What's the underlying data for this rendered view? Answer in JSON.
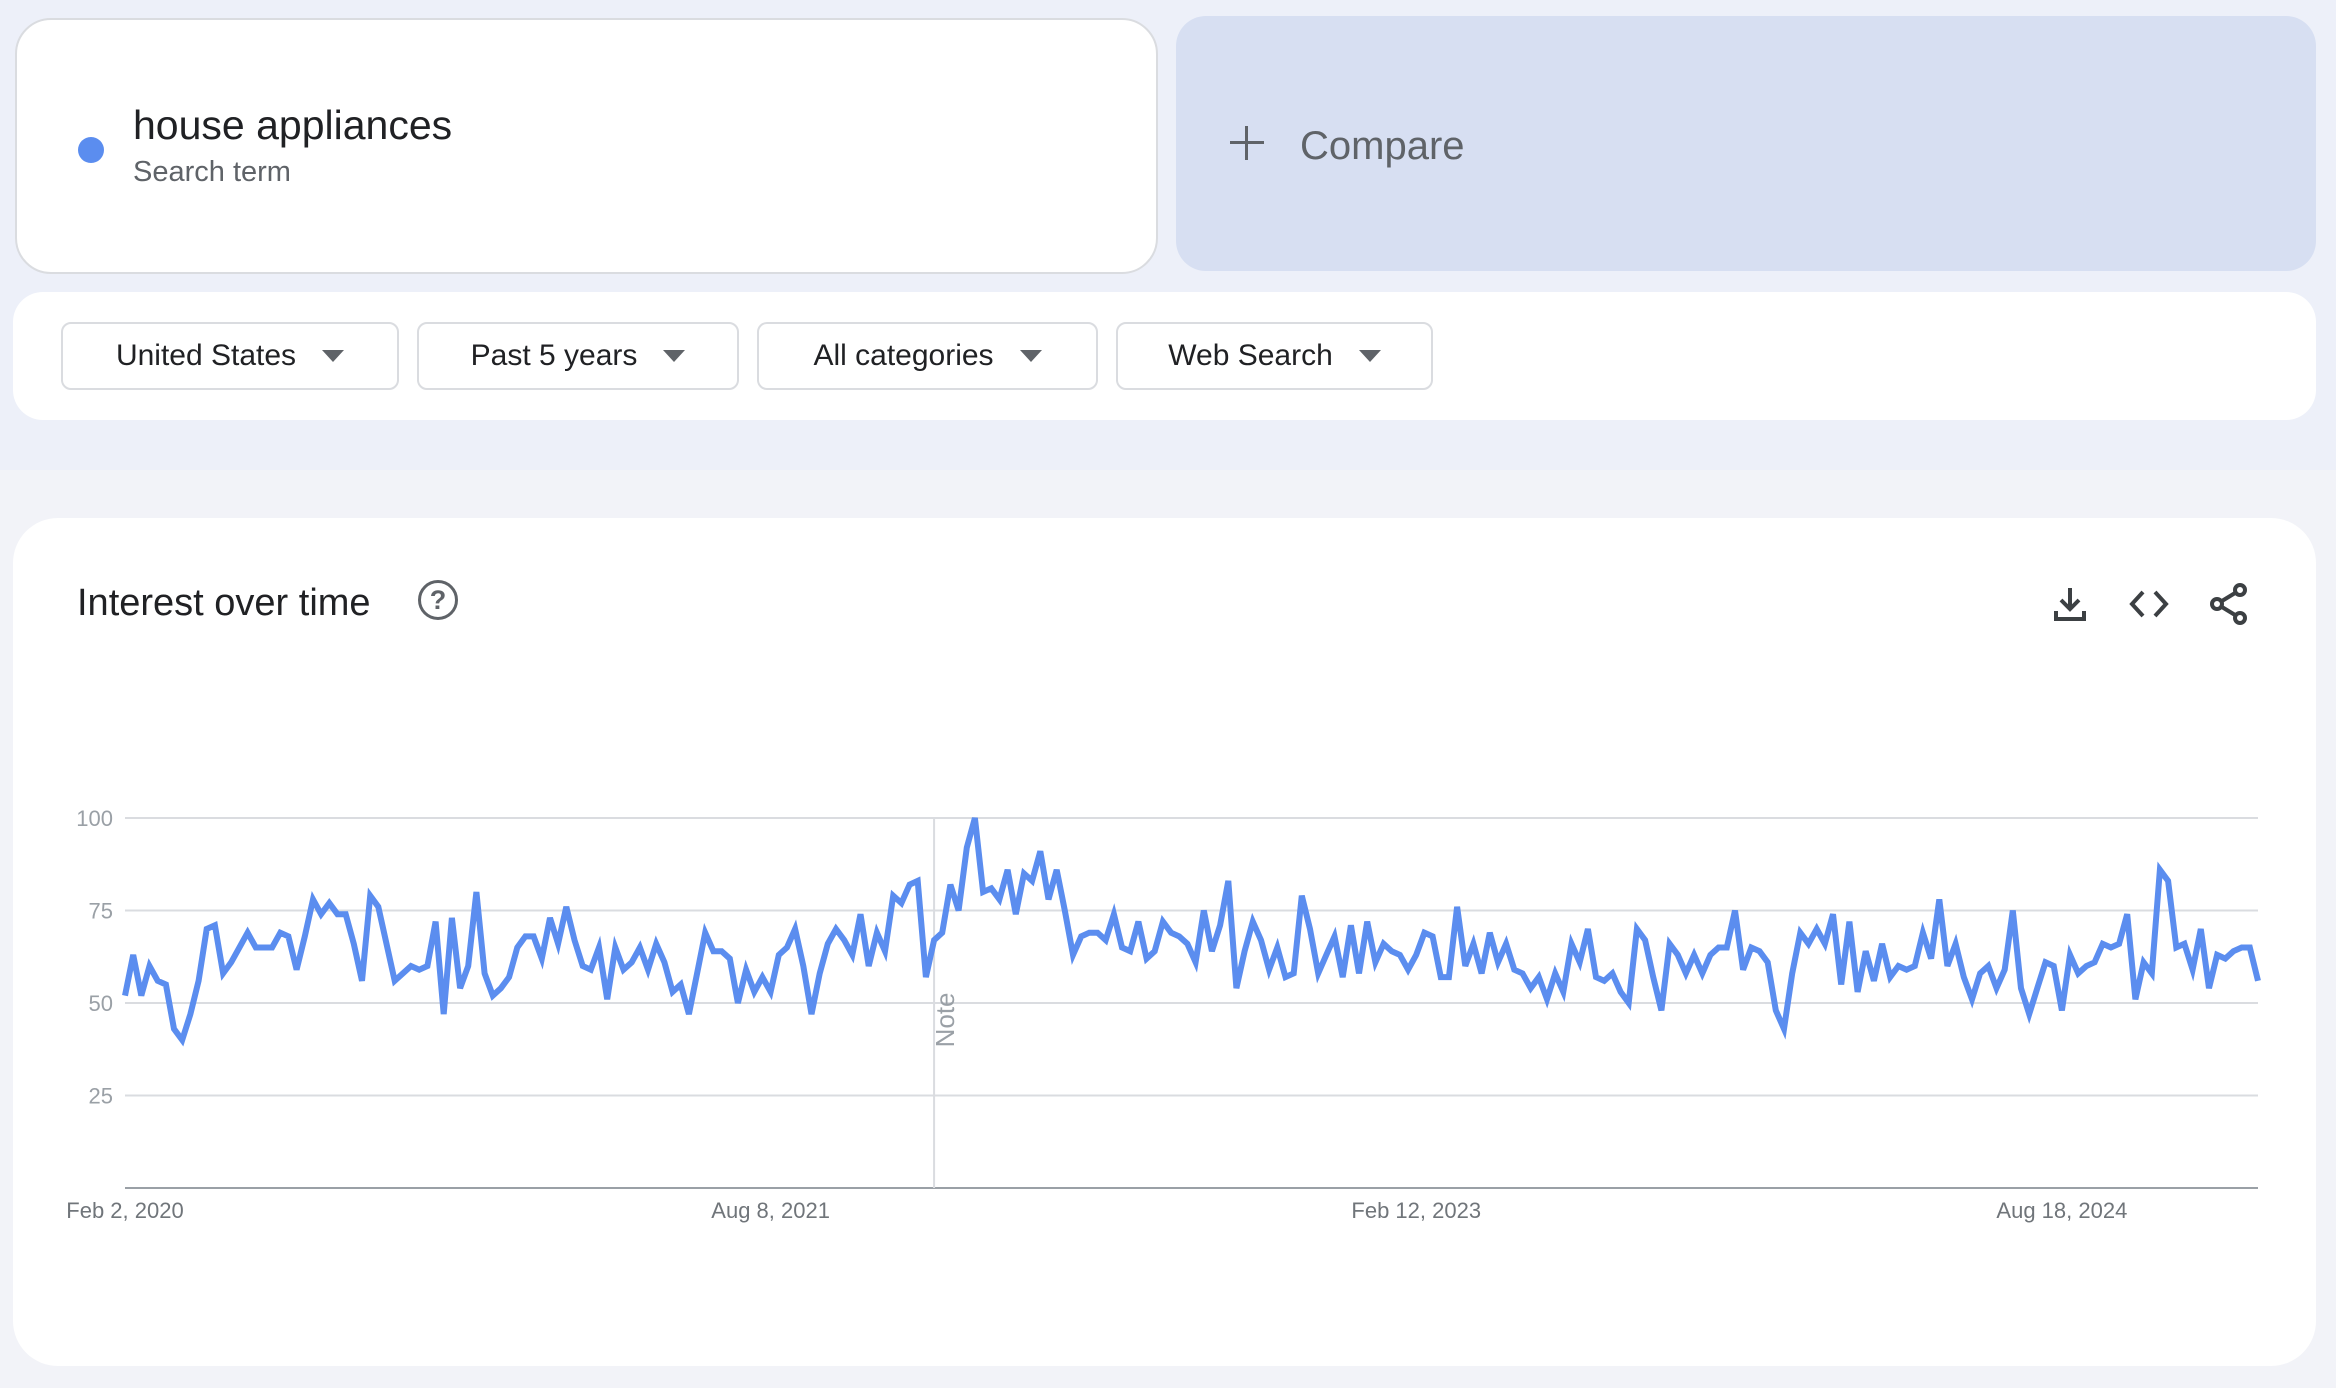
{
  "search_term": {
    "label": "house appliances",
    "sublabel": "Search term",
    "color": "#5b8def"
  },
  "compare": {
    "label": "Compare",
    "icon": "plus-icon"
  },
  "filters": [
    {
      "label": "United States"
    },
    {
      "label": "Past 5 years"
    },
    {
      "label": "All categories"
    },
    {
      "label": "Web Search"
    }
  ],
  "panel": {
    "title": "Interest over time",
    "help_icon": "?",
    "actions": [
      "download-icon",
      "embed-code-icon",
      "share-icon"
    ]
  },
  "chart_data": {
    "type": "line",
    "title": "Interest over time",
    "x_start": "2020-02-02",
    "x_interval": "weekly",
    "x_tick_labels": [
      "Feb 2, 2020",
      "Aug 8, 2021",
      "Feb 12, 2023",
      "Aug 18, 2024"
    ],
    "x_tick_dates": [
      "2020-02-02",
      "2021-08-08",
      "2023-02-12",
      "2024-08-18"
    ],
    "y_ticks": [
      25,
      50,
      75,
      100
    ],
    "ylim": [
      0,
      100
    ],
    "grid": true,
    "annotation": {
      "label": "Note",
      "date": "2021-12-26"
    },
    "series": [
      {
        "name": "house appliances",
        "color": "#5b8def",
        "values": [
          52,
          63,
          52,
          60,
          56,
          55,
          43,
          40,
          47,
          56,
          70,
          71,
          58,
          61,
          65,
          69,
          65,
          65,
          65,
          69,
          68,
          59,
          68,
          78,
          74,
          77,
          74,
          74,
          66,
          56,
          79,
          76,
          66,
          56,
          58,
          60,
          59,
          60,
          72,
          47,
          73,
          54,
          60,
          80,
          58,
          52,
          54,
          57,
          65,
          68,
          68,
          62,
          73,
          66,
          76,
          67,
          60,
          59,
          65,
          51,
          65,
          59,
          61,
          65,
          59,
          66,
          61,
          53,
          55,
          47,
          58,
          69,
          64,
          64,
          62,
          50,
          59,
          53,
          57,
          53,
          63,
          65,
          70,
          60,
          47,
          58,
          66,
          70,
          67,
          63,
          74,
          60,
          69,
          64,
          79,
          77,
          82,
          83,
          57,
          67,
          69,
          82,
          75,
          92,
          100,
          80,
          81,
          78,
          86,
          74,
          85,
          83,
          91,
          78,
          86,
          75,
          63,
          68,
          69,
          69,
          67,
          74,
          65,
          64,
          72,
          62,
          64,
          72,
          69,
          68,
          66,
          61,
          75,
          64,
          71,
          83,
          54,
          64,
          72,
          67,
          59,
          65,
          57,
          58,
          79,
          70,
          58,
          63,
          68,
          57,
          71,
          58,
          72,
          61,
          66,
          64,
          63,
          59,
          63,
          69,
          68,
          57,
          57,
          76,
          60,
          66,
          58,
          69,
          61,
          66,
          59,
          58,
          54,
          57,
          51,
          58,
          53,
          66,
          61,
          70,
          57,
          56,
          58,
          53,
          50,
          70,
          67,
          57,
          48,
          66,
          63,
          58,
          63,
          58,
          63,
          65,
          65,
          75,
          59,
          65,
          64,
          61,
          48,
          43,
          58,
          69,
          66,
          70,
          66,
          74,
          55,
          72,
          53,
          64,
          56,
          66,
          57,
          60,
          59,
          60,
          69,
          62,
          78,
          60,
          66,
          57,
          51,
          58,
          60,
          54,
          59,
          75,
          54,
          47,
          54,
          61,
          60,
          48,
          63,
          58,
          60,
          61,
          66,
          65,
          66,
          74,
          51,
          61,
          58,
          86,
          83,
          65,
          66,
          59,
          70,
          54,
          63,
          62,
          64,
          65,
          65,
          56
        ]
      }
    ]
  }
}
